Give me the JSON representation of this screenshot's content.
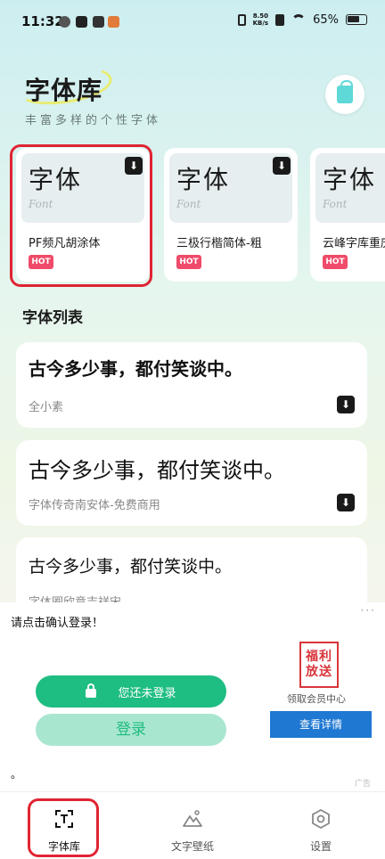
{
  "status_bar": {
    "time": "11:32",
    "net_speed_top": "8.50",
    "net_speed_bottom": "KB/s",
    "battery": "65%"
  },
  "header": {
    "title": "字体库",
    "subtitle": "丰富多样的个性字体"
  },
  "featured": [
    {
      "glyphs": "字体",
      "font_word": "Font",
      "name": "PF频凡胡涂体",
      "badge": "HOT",
      "highlighted": true
    },
    {
      "glyphs": "字体",
      "font_word": "Font",
      "name": "三极行楷简体-粗",
      "badge": "HOT",
      "highlighted": false
    },
    {
      "glyphs": "字体",
      "font_word": "Font",
      "name": "云峰字库重庆",
      "badge": "HOT",
      "highlighted": false
    }
  ],
  "font_list": {
    "title": "字体列表",
    "items": [
      {
        "sample": "古今多少事，都付笑谈中。",
        "name": "全小素"
      },
      {
        "sample": "古今多少事，都付笑谈中。",
        "name": "字体传奇南安体-免费商用"
      },
      {
        "sample": "古今多少事，都付笑谈中。",
        "name": "字体圈欣意吉祥宋"
      }
    ]
  },
  "ad_panel": {
    "prompt": "请点击确认登录！",
    "not_logged_in": "您还未登录",
    "login_button": "登录",
    "badge_line1": "福利",
    "badge_line2": "放送",
    "vip_text": "领取会员中心",
    "detail_button": "查看详情",
    "dot": "。",
    "ad_label": "广告",
    "more": "···"
  },
  "bottom_nav": [
    {
      "label": "字体库",
      "icon": "font-library-icon",
      "active": true
    },
    {
      "label": "文字壁纸",
      "icon": "wallpaper-icon",
      "active": false
    },
    {
      "label": "设置",
      "icon": "settings-icon",
      "active": false
    }
  ],
  "colors": {
    "accent_red": "#e02433",
    "hot": "#f04b6a",
    "green": "#1ebd82",
    "blue": "#1f78d1"
  }
}
